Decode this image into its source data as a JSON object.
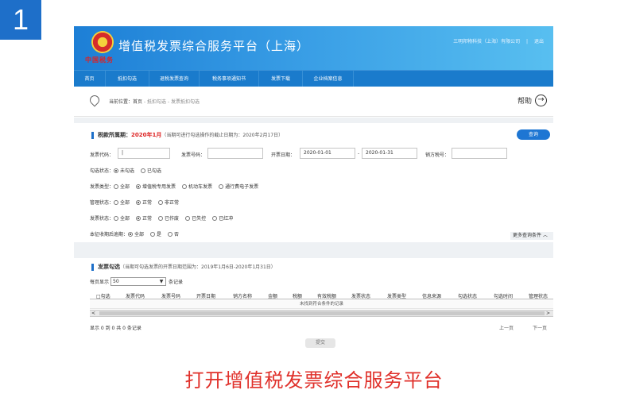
{
  "step_number": "1",
  "caption": "打开增值税发票综合服务平台",
  "header": {
    "emblem_text": "中国税务",
    "title": "增值税发票综合服务平台（上海）",
    "company": "三明邦物科技（上海）有限公司",
    "logout": "退出"
  },
  "nav": [
    "首页",
    "抵扣勾选",
    "退税发票查询",
    "税务事项通知书",
    "发票下载",
    "企业档案信息"
  ],
  "breadcrumb": {
    "prefix": "当前位置：",
    "home": "首页",
    "path": " - 抵扣勾选 - 发票抵扣勾选"
  },
  "help": {
    "label": "帮助",
    "arrow": "→"
  },
  "period": {
    "label": "税款所属期：",
    "value": "2020年1月",
    "note": "（当期可进行勾选操作的截止日期为：2020年2月17日）"
  },
  "query_button": "查询",
  "form": {
    "invoice_code_label": "发票代码：",
    "invoice_code_value": "|",
    "invoice_number_label": "发票号码：",
    "invoice_date_label": "开票日期：",
    "date_from": "2020-01-01",
    "date_sep": "-",
    "date_to": "2020-01-31",
    "seller_tax_label": "销方税号："
  },
  "radio_groups": [
    {
      "label": "勾选状态：",
      "options": [
        {
          "text": "未勾选",
          "checked": true
        },
        {
          "text": "已勾选",
          "checked": false
        }
      ]
    },
    {
      "label": "发票类型：",
      "options": [
        {
          "text": "全部",
          "checked": false
        },
        {
          "text": "增值税专用发票",
          "checked": true
        },
        {
          "text": "机动车发票",
          "checked": false
        },
        {
          "text": "通行费电子发票",
          "checked": false
        }
      ]
    },
    {
      "label": "管理状态：",
      "options": [
        {
          "text": "全部",
          "checked": false
        },
        {
          "text": "正常",
          "checked": true
        },
        {
          "text": "非正常",
          "checked": false
        }
      ]
    },
    {
      "label": "发票状态：",
      "options": [
        {
          "text": "全部",
          "checked": false
        },
        {
          "text": "正常",
          "checked": true
        },
        {
          "text": "已作废",
          "checked": false
        },
        {
          "text": "已失控",
          "checked": false
        },
        {
          "text": "已红冲",
          "checked": false
        }
      ]
    },
    {
      "label": "本征收期后逾期：",
      "options": [
        {
          "text": "全部",
          "checked": true
        },
        {
          "text": "是",
          "checked": false
        },
        {
          "text": "否",
          "checked": false
        }
      ]
    }
  ],
  "more_conditions": "更多查询条件 ︿",
  "selection": {
    "title": "发票勾选",
    "note": "（当期可勾选发票的开票日期范围为：2019年1月6日-2020年1月31日）",
    "page_size_label": "每页显示",
    "page_size_value": "50",
    "page_size_suffix": "条记录",
    "columns": [
      "勾选",
      "发票代码",
      "发票号码",
      "开票日期",
      "销方名称",
      "金额",
      "税额",
      "有效税额",
      "发票状态",
      "发票类型",
      "信息来源",
      "勾选状态",
      "勾选时间",
      "管理状态"
    ],
    "empty_text": "未找到符合条件的记录",
    "scroll_left": "<",
    "scroll_right": ">",
    "footer_info": "显示 0 到 0 共 0 条记录",
    "prev": "上一页",
    "next": "下一页",
    "submit": "提交"
  },
  "colors": {
    "header_start": "#1d7fd6",
    "header_end": "#58bff0",
    "nav_bg": "#1a7bcc",
    "accent": "#1e76d3",
    "caption_red": "#e0312b",
    "period_red": "#dd2222",
    "badge_blue": "#1e6fc9"
  }
}
